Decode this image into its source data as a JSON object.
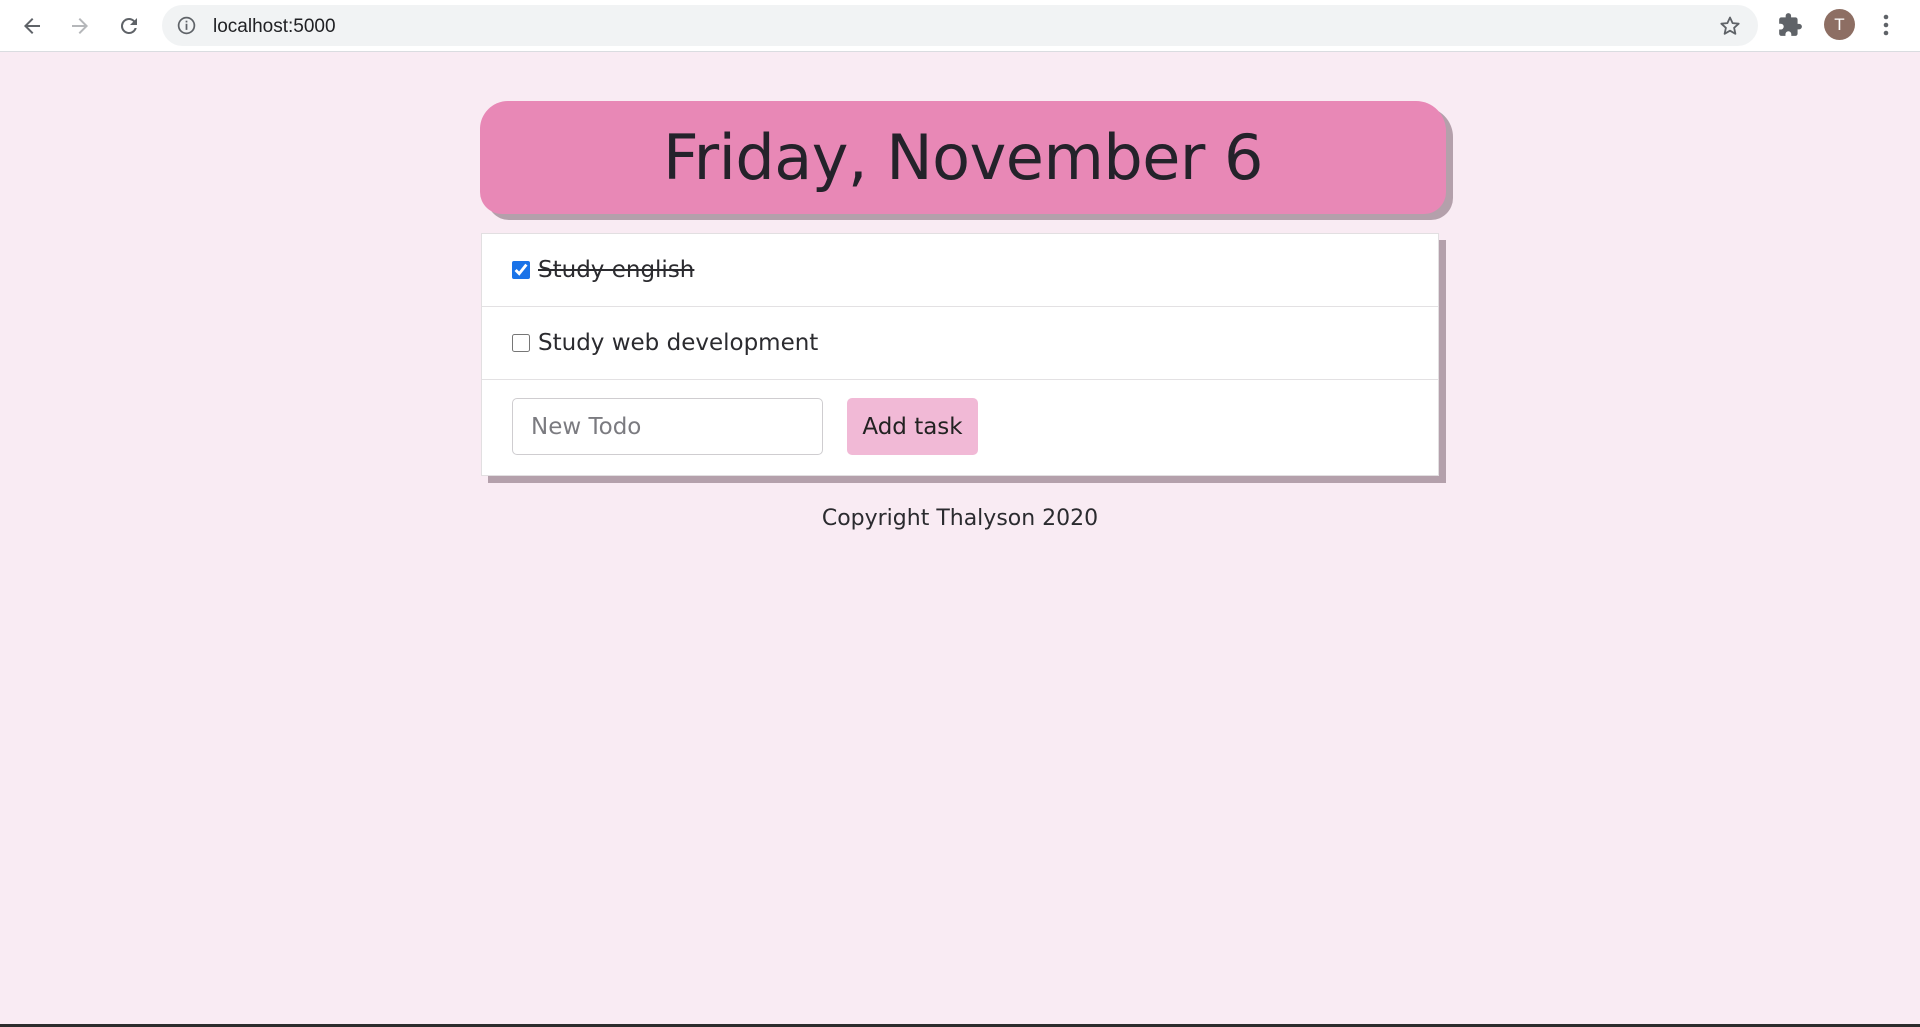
{
  "browser": {
    "url": "localhost:5000",
    "avatar_letter": "T",
    "icons": [
      "back-arrow-icon",
      "forward-arrow-icon",
      "reload-icon",
      "info-icon",
      "star-icon",
      "extensions-icon",
      "menu-icon"
    ]
  },
  "header": {
    "date": "Friday, November 6"
  },
  "todos": [
    {
      "text": "Study english",
      "checked": true
    },
    {
      "text": "Study web development",
      "checked": false
    }
  ],
  "new_todo": {
    "placeholder": "New Todo",
    "value": "",
    "button_label": "Add task"
  },
  "footer": {
    "text": "Copyright Thalyson 2020"
  },
  "colors": {
    "page_background": "#f9ebf3",
    "header_background": "#e888b6",
    "button_background": "#f1b9d6",
    "shadow": "#b4a0ab"
  }
}
